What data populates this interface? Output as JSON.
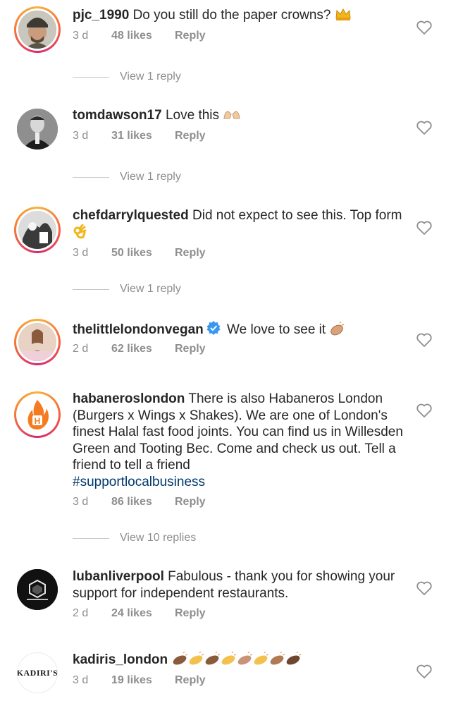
{
  "comments": [
    {
      "username": "pjc_1990",
      "text": " Do you still do the paper crowns? ",
      "emoji": "crown-emoji",
      "time": "3 d",
      "likes": "48 likes",
      "reply": "Reply",
      "view_replies": "View 1 reply"
    },
    {
      "username": "tomdawson17",
      "text": " Love this ",
      "emoji": "raised-hands-emoji",
      "time": "3 d",
      "likes": "31 likes",
      "reply": "Reply",
      "view_replies": "View 1 reply"
    },
    {
      "username": "chefdarrylquested",
      "text": " Did not expect to see this. Top form ",
      "emoji": "ok-hand-emoji",
      "time": "3 d",
      "likes": "50 likes",
      "reply": "Reply",
      "view_replies": "View 1 reply"
    },
    {
      "username": "thelittlelondonvegan",
      "text": " We love to see it ",
      "emoji": "clapping-hands-emoji",
      "verified": true,
      "time": "2 d",
      "likes": "62 likes",
      "reply": "Reply"
    },
    {
      "username": "habaneroslondon",
      "text": " There is also Habaneros London (Burgers x Wings x Shakes). We are one of London's finest Halal  fast food joints. You can find us in Willesden Green and Tooting Bec. Come and check us out. Tell a friend to tell a friend ",
      "hashtag": "#supportlocalbusiness",
      "time": "3 d",
      "likes": "86 likes",
      "reply": "Reply",
      "view_replies": "View 10 replies"
    },
    {
      "username": "lubanliverpool",
      "text": " Fabulous - thank you for showing your support for independent restaurants.",
      "time": "2 d",
      "likes": "24 likes",
      "reply": "Reply"
    },
    {
      "username": "kadiris_london",
      "text": " ",
      "emoji": "clapping-hands-emoji x8",
      "time": "3 d",
      "likes": "19 likes",
      "reply": "Reply",
      "avatar_logo": "KADIRI'S"
    }
  ]
}
